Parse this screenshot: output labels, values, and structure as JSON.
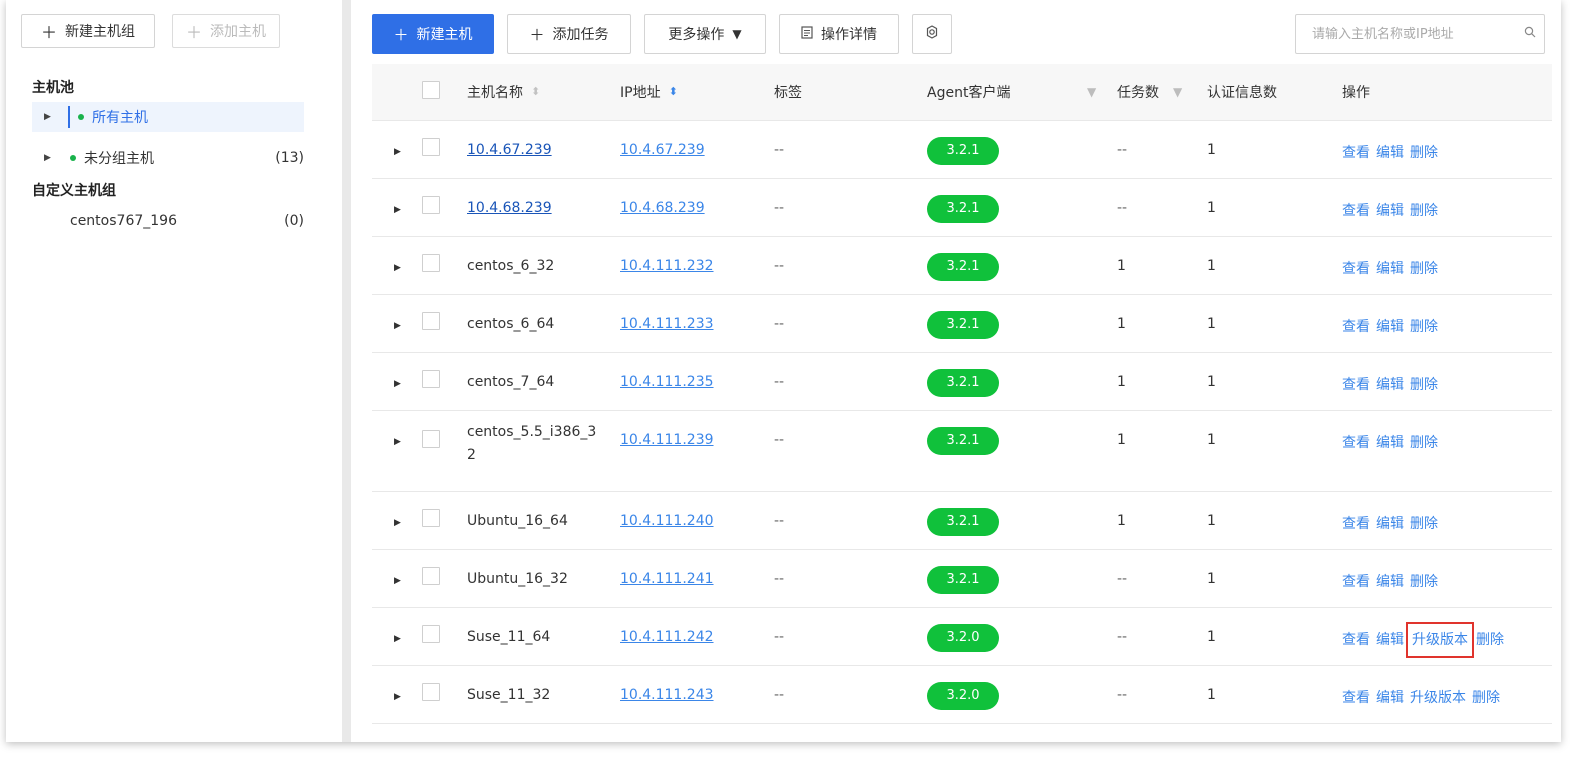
{
  "sidebar": {
    "new_group_label": "新建主机组",
    "add_host_label": "添加主机",
    "pool_title": "主机池",
    "custom_title": "自定义主机组",
    "items": [
      {
        "label": "所有主机",
        "count": ""
      },
      {
        "label": "未分组主机",
        "count": "(13)"
      }
    ],
    "custom_items": [
      {
        "label": "centos767_196",
        "count": "(0)"
      }
    ]
  },
  "toolbar": {
    "new_host_label": "新建主机",
    "add_task_label": "添加任务",
    "more_ops_label": "更多操作",
    "op_detail_label": "操作详情",
    "search_placeholder": "请输入主机名称或IP地址"
  },
  "table": {
    "columns": {
      "name": "主机名称",
      "ip": "IP地址",
      "tag": "标签",
      "agent": "Agent客户端",
      "tasks": "任务数",
      "auth": "认证信息数",
      "ops": "操作"
    },
    "actions": {
      "view": "查看",
      "edit": "编辑",
      "upgrade": "升级版本",
      "delete": "删除"
    },
    "rows": [
      {
        "name": "10.4.67.239",
        "ip": "10.4.67.239",
        "tag": "--",
        "agent": "3.2.1",
        "tasks": "--",
        "auth": "1"
      },
      {
        "name": "10.4.68.239",
        "ip": "10.4.68.239",
        "tag": "--",
        "agent": "3.2.1",
        "tasks": "--",
        "auth": "1"
      },
      {
        "name": "centos_6_32",
        "ip": "10.4.111.232",
        "tag": "--",
        "agent": "3.2.1",
        "tasks": "1",
        "auth": "1"
      },
      {
        "name": "centos_6_64",
        "ip": "10.4.111.233",
        "tag": "--",
        "agent": "3.2.1",
        "tasks": "1",
        "auth": "1"
      },
      {
        "name": "centos_7_64",
        "ip": "10.4.111.235",
        "tag": "--",
        "agent": "3.2.1",
        "tasks": "1",
        "auth": "1"
      },
      {
        "name_line1": "centos_5.5_i386_3",
        "name_line2": "2",
        "ip": "10.4.111.239",
        "tag": "--",
        "agent": "3.2.1",
        "tasks": "1",
        "auth": "1"
      },
      {
        "name": "Ubuntu_16_64",
        "ip": "10.4.111.240",
        "tag": "--",
        "agent": "3.2.1",
        "tasks": "1",
        "auth": "1"
      },
      {
        "name": "Ubuntu_16_32",
        "ip": "10.4.111.241",
        "tag": "--",
        "agent": "3.2.1",
        "tasks": "--",
        "auth": "1"
      },
      {
        "name": "Suse_11_64",
        "ip": "10.4.111.242",
        "tag": "--",
        "agent": "3.2.0",
        "tasks": "--",
        "auth": "1"
      },
      {
        "name": "Suse_11_32",
        "ip": "10.4.111.243",
        "tag": "--",
        "agent": "3.2.0",
        "tasks": "--",
        "auth": "1"
      }
    ]
  },
  "colors": {
    "primary": "#2f6fe6",
    "agent_badge": "#10c13b",
    "highlight_box": "#e0342d",
    "link": "#3b86e8"
  }
}
